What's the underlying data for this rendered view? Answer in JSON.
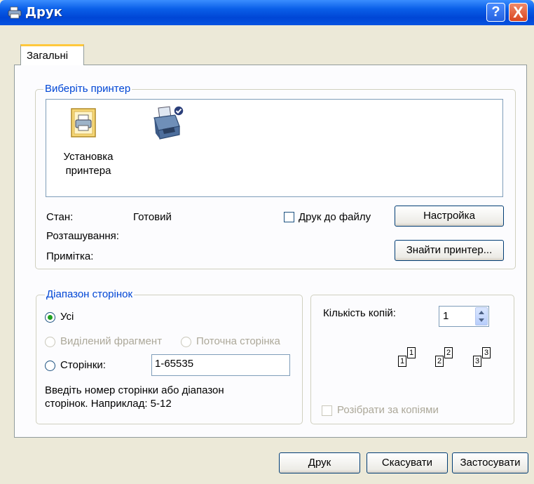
{
  "window": {
    "title": "Друк",
    "help_label": "?",
    "close_label": "X"
  },
  "tabs": [
    {
      "label": "Загальні"
    }
  ],
  "printer_group": {
    "legend": "Виберіть принтер",
    "items": [
      {
        "label_line1": "Установка",
        "label_line2": "принтера",
        "icon": "add-printer-icon"
      },
      {
        "label_line1": "",
        "label_line2": "",
        "icon": "default-printer-icon"
      }
    ],
    "status_label": "Стан:",
    "status_value": "Готовий",
    "location_label": "Розташування:",
    "location_value": "",
    "comment_label": "Примітка:",
    "comment_value": "",
    "print_to_file": {
      "label": "Друк до файлу",
      "checked": false
    },
    "setup_button": "Настройка",
    "find_printer_button": "Знайти принтер..."
  },
  "page_range": {
    "legend": "Діапазон сторінок",
    "all": "Усі",
    "selection": "Виділений фрагмент",
    "current_page": "Поточна сторінка",
    "pages": "Сторінки:",
    "pages_value": "1-65535",
    "help_line1": "Введіть номер сторінки або діапазон",
    "help_line2": "сторінок.  Наприклад: 5-12",
    "selected": "all"
  },
  "copies": {
    "label": "Кількість копій:",
    "value": "1",
    "collate": {
      "label": "Розібрати за копіями",
      "checked": false
    },
    "sheets": [
      "1",
      "1",
      "2",
      "2",
      "3",
      "3"
    ]
  },
  "footer": {
    "print": "Друк",
    "cancel": "Скасувати",
    "apply": "Застосувати"
  },
  "colors": {
    "accent": "#0046d5",
    "titlebar": "#0054e3",
    "dialog_bg": "#ece9d8"
  }
}
